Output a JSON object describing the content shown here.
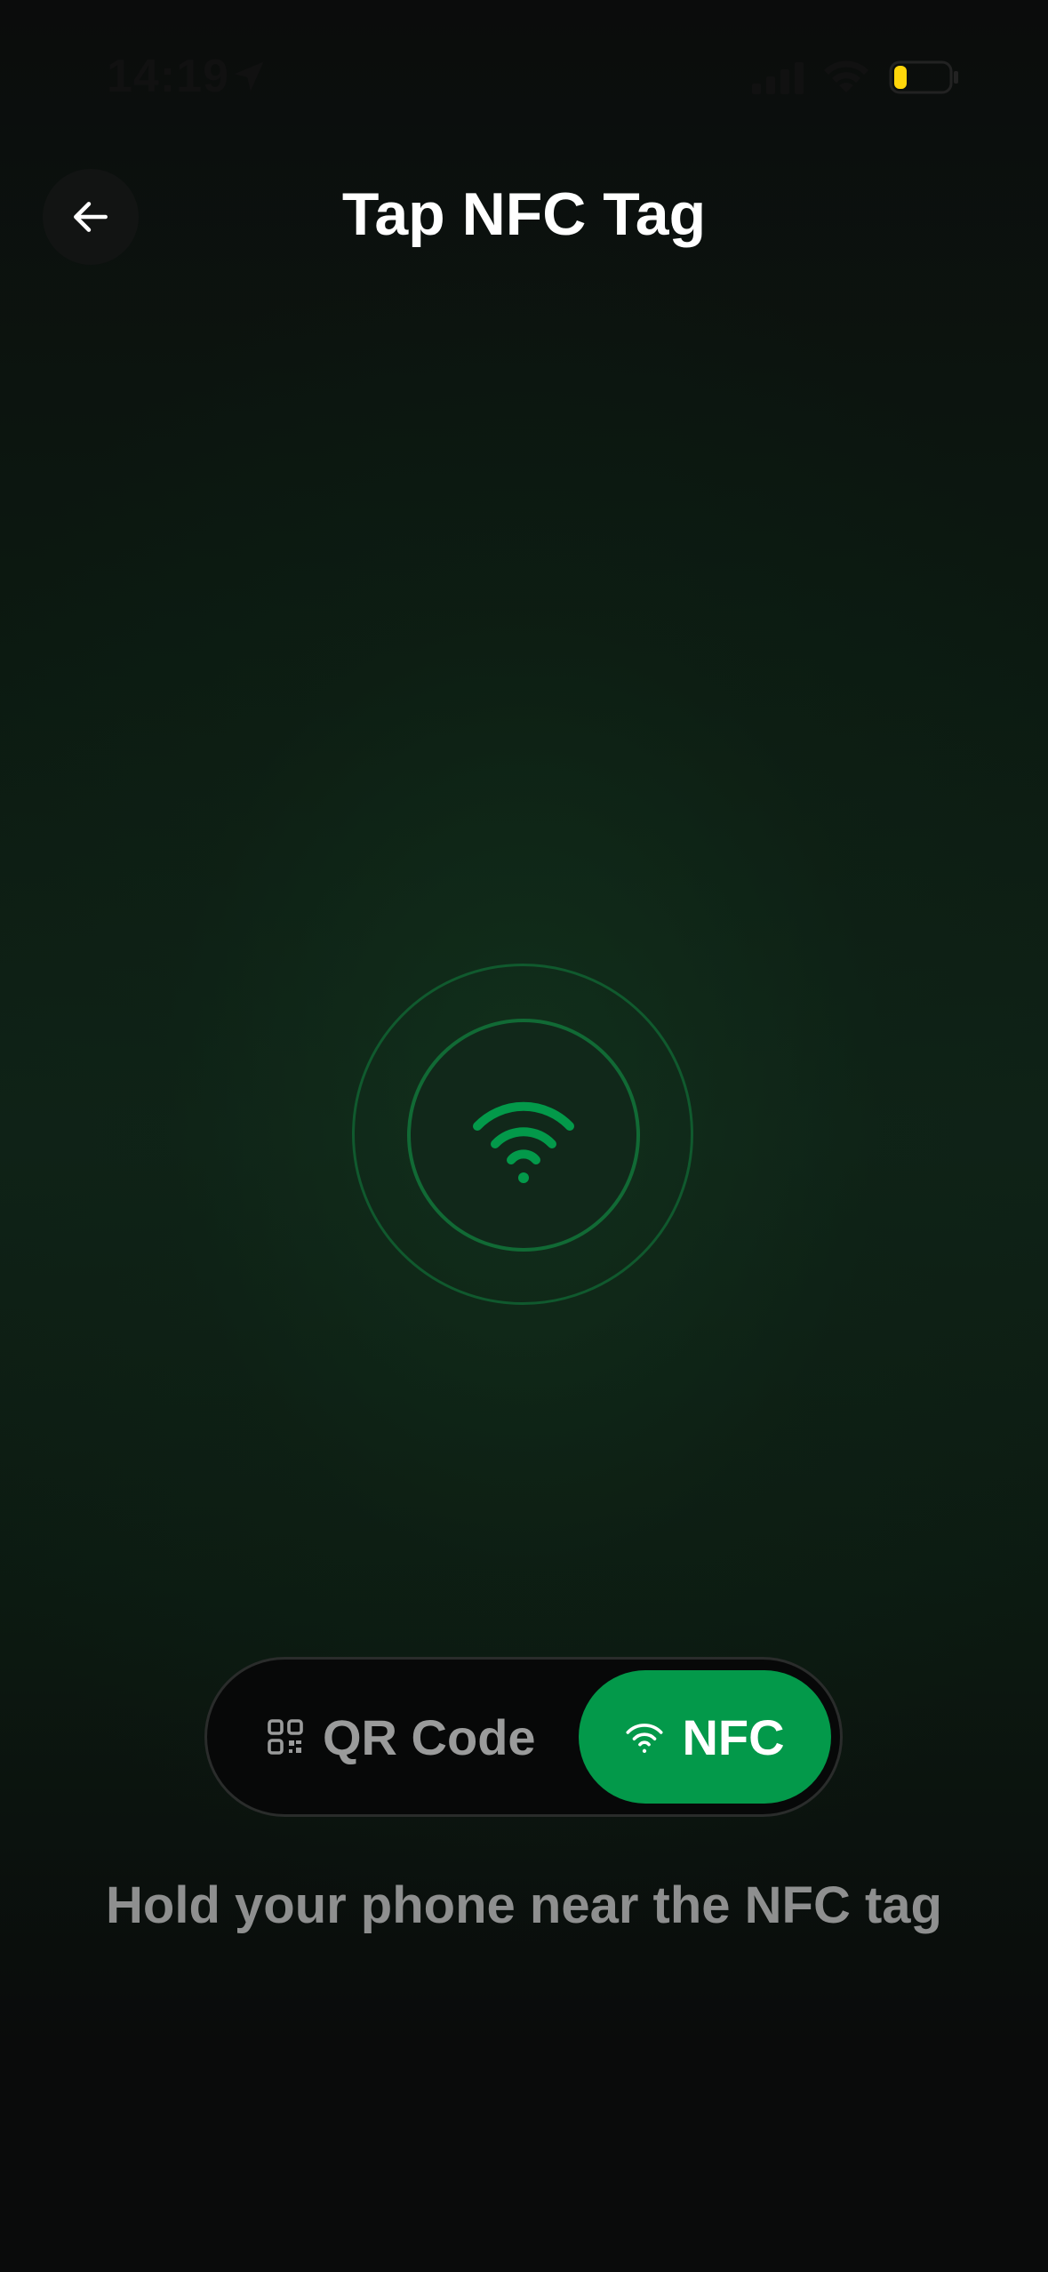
{
  "status_bar": {
    "time": "14:19",
    "battery_color": "#ffd60a"
  },
  "header": {
    "title": "Tap NFC Tag",
    "back_icon": "arrow-left-icon"
  },
  "nfc_indicator": {
    "icon": "nfc-waves-icon",
    "accent_color": "#03994a"
  },
  "mode_toggle": {
    "options": [
      {
        "label": "QR Code",
        "icon": "qr-code-icon",
        "selected": false
      },
      {
        "label": "NFC",
        "icon": "nfc-icon",
        "selected": true
      }
    ]
  },
  "instruction": "Hold your phone near the NFC tag"
}
